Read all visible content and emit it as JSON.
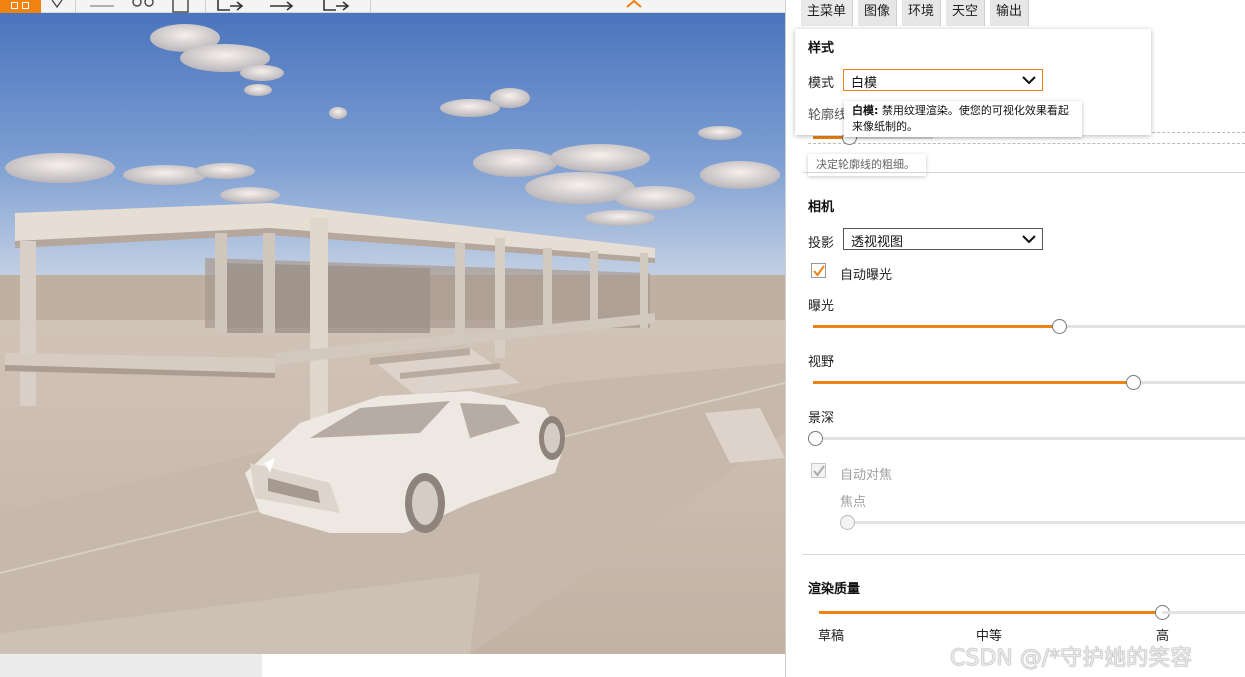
{
  "colors": {
    "accent": "#f0820f",
    "sky_top": "#4f7ac2",
    "ground": "#cbbcae"
  },
  "toolbar": {
    "icons": [
      "grid-icon",
      "pin-icon",
      "line-icon",
      "glasses-icon",
      "save-icon",
      "export-icon",
      "export-icon",
      "export-icon"
    ],
    "collapse_icon": "chevron-up-icon"
  },
  "panel": {
    "tabs": [
      {
        "label": "主菜单",
        "active": true
      },
      {
        "label": "图像",
        "active": false
      },
      {
        "label": "环境",
        "active": false
      },
      {
        "label": "天空",
        "active": false
      },
      {
        "label": "输出",
        "active": false
      }
    ],
    "style": {
      "heading": "样式",
      "mode_label": "模式",
      "mode_value": "白模",
      "outline_label": "轮廓线",
      "mode_tooltip_title": "白模:",
      "mode_tooltip_text": "禁用纹理渲染。使您的可视化效果看起来像纸制的。",
      "outline_tooltip": "决定轮廓线的粗细。"
    },
    "camera": {
      "heading": "相机",
      "projection_label": "投影",
      "projection_value": "透视视图",
      "auto_exposure_label": "自动曝光",
      "auto_exposure_checked": true,
      "exposure_label": "曝光",
      "exposure_value": 0.57,
      "fov_label": "视野",
      "fov_value": 0.74,
      "dof_label": "景深",
      "dof_value": 0.0,
      "auto_focus_label": "自动对焦",
      "auto_focus_checked": true,
      "focus_label": "焦点",
      "focus_value": 0.0
    },
    "render": {
      "heading": "渲染质量",
      "value": 1.0,
      "levels": [
        "草稿",
        "中等",
        "高"
      ]
    }
  },
  "watermark": "CSDN @/*守护她的笑容"
}
